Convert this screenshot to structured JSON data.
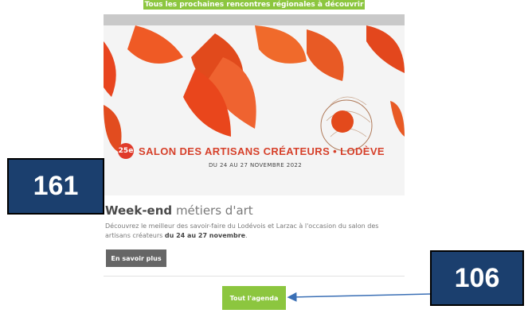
{
  "top_banner": {
    "text": "Tous les prochaines rencontres régionales à découvrir"
  },
  "hero": {
    "badge": "25e",
    "title": "SALON DES ARTISANS CRÉATEURS • LODÈVE",
    "dates": "DU 24 AU 27 NOVEMBRE 2022"
  },
  "event": {
    "title_bold": "Week-end",
    "title_light": "métiers d'art",
    "desc_part1": "Découvrez le meilleur des savoir-faire du Lodévois et Larzac à l'occasion du salon des artisans créateurs ",
    "desc_bold": "du 24 au 27 novembre",
    "desc_end": "."
  },
  "buttons": {
    "more": "En savoir plus",
    "agenda": "Tout l'agenda"
  },
  "annotations": {
    "left_number": "161",
    "right_number": "106"
  },
  "colors": {
    "green": "#8cc63f",
    "navy": "#1b3f6e",
    "red": "#d6402a",
    "arrow": "#3a6fb5"
  }
}
